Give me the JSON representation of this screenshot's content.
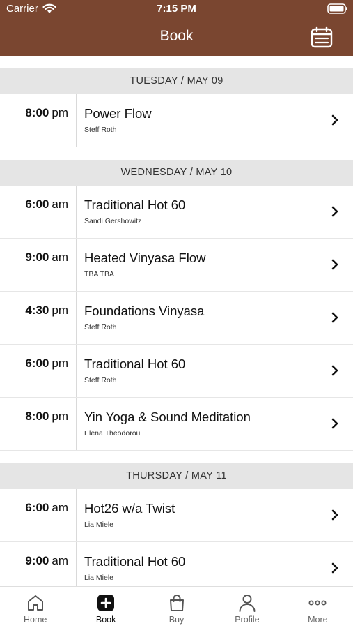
{
  "status_bar": {
    "carrier": "Carrier",
    "time": "7:15 PM"
  },
  "nav": {
    "title": "Book",
    "calendar_icon": "calendar-icon"
  },
  "days": [
    {
      "label": "TUESDAY / MAY 09",
      "classes": [
        {
          "time": "8:00",
          "ampm": "pm",
          "name": "Power Flow",
          "instructor": "Steff Roth"
        }
      ]
    },
    {
      "label": "WEDNESDAY / MAY 10",
      "classes": [
        {
          "time": "6:00",
          "ampm": "am",
          "name": "Traditional Hot 60",
          "instructor": "Sandi Gershowitz"
        },
        {
          "time": "9:00",
          "ampm": "am",
          "name": "Heated Vinyasa Flow",
          "instructor": "TBA TBA"
        },
        {
          "time": "4:30",
          "ampm": "pm",
          "name": "Foundations Vinyasa",
          "instructor": "Steff Roth"
        },
        {
          "time": "6:00",
          "ampm": "pm",
          "name": "Traditional Hot 60",
          "instructor": "Steff Roth"
        },
        {
          "time": "8:00",
          "ampm": "pm",
          "name": "Yin Yoga & Sound Meditation",
          "instructor": "Elena Theodorou"
        }
      ]
    },
    {
      "label": "THURSDAY / MAY 11",
      "classes": [
        {
          "time": "6:00",
          "ampm": "am",
          "name": "Hot26 w/a Twist",
          "instructor": "Lia Miele"
        },
        {
          "time": "9:00",
          "ampm": "am",
          "name": "Traditional Hot 60",
          "instructor": "Lia Miele"
        }
      ]
    }
  ],
  "tabbar": {
    "home": "Home",
    "book": "Book",
    "buy": "Buy",
    "profile": "Profile",
    "more": "More"
  },
  "colors": {
    "header": "#7a4630",
    "section_bg": "#e5e5e5"
  }
}
